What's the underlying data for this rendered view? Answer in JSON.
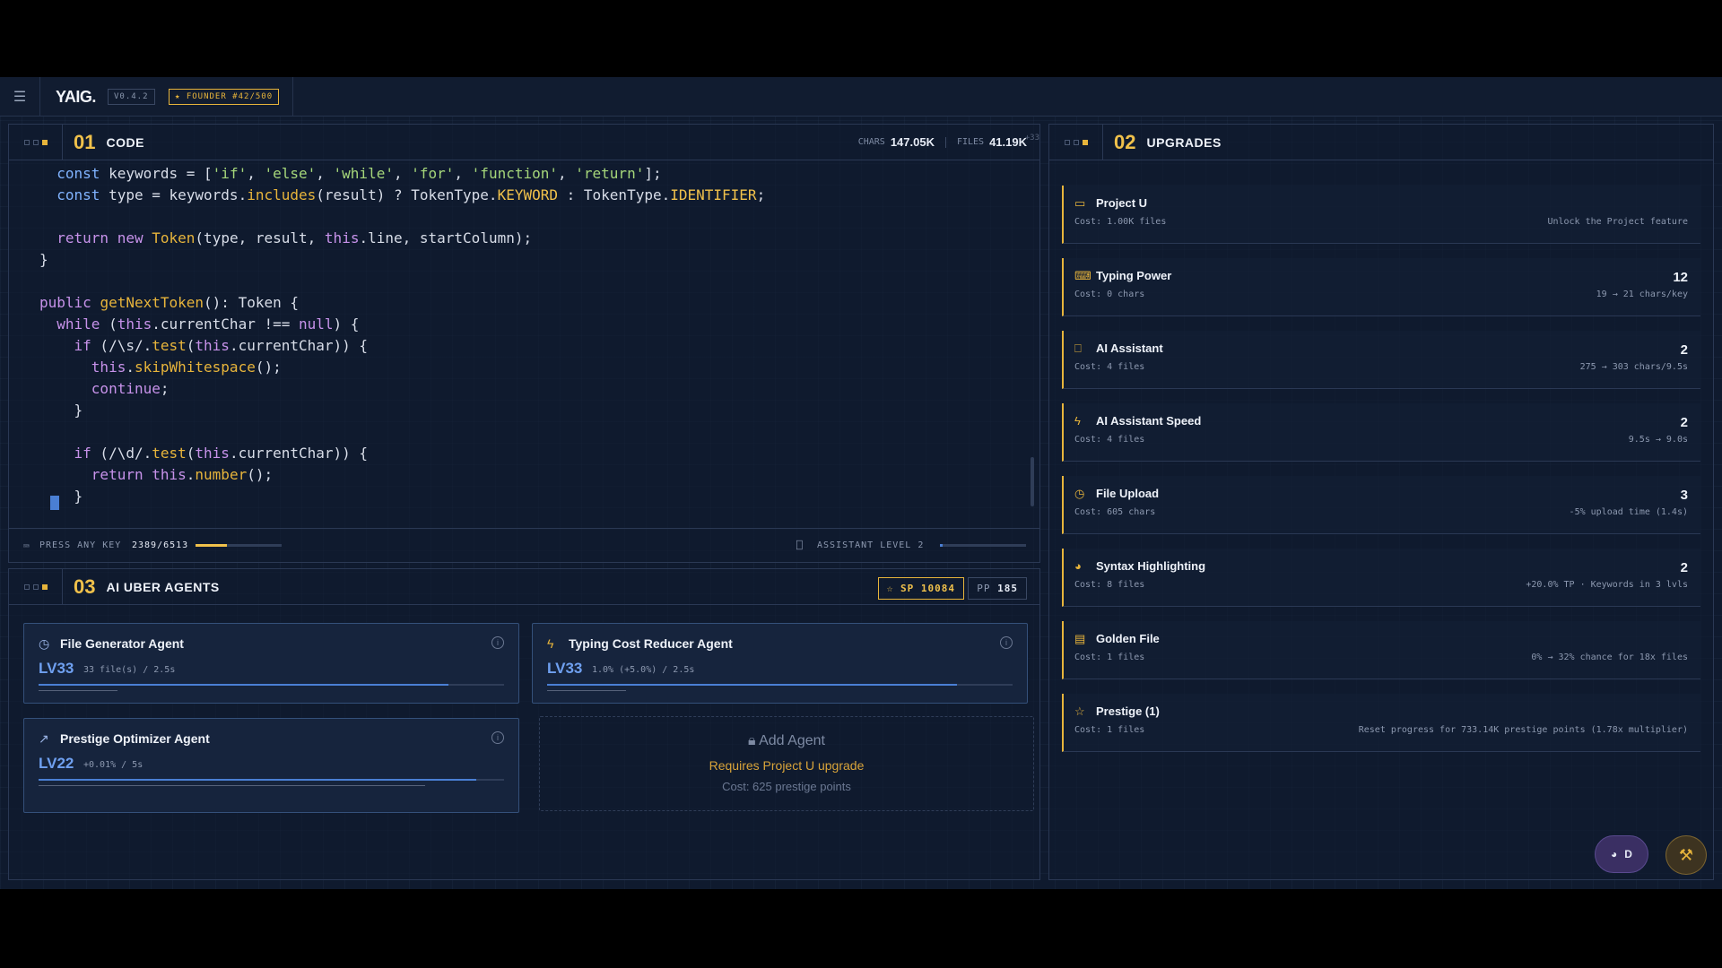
{
  "topbar": {
    "menu_icon": "☰",
    "logo": "YAIG.",
    "version": "V0.4.2",
    "founder": "★ FOUNDER #42/500"
  },
  "code_panel": {
    "num": "01",
    "title": "CODE",
    "chars_label": "CHARS",
    "chars_value": "147.05K",
    "files_label": "FILES",
    "files_value": "41.19K",
    "files_delta": "+33",
    "press_label": "PRESS ANY KEY",
    "progress_text": "2389/6513",
    "progress_fraction": 0.367,
    "assistant_label": "ASSISTANT LEVEL 2",
    "assistant_fraction": 0.03
  },
  "agents_panel": {
    "num": "03",
    "title": "AI UBER AGENTS",
    "sp_label": "SP",
    "sp_value": "10084",
    "pp_label": "PP",
    "pp_value": "185",
    "agents": [
      {
        "name": "File Generator Agent",
        "level": "LV33",
        "stat": "33 file(s) / 2.5s",
        "bar": 0.88,
        "bar2": 0.17,
        "icon": "timer-icon"
      },
      {
        "name": "Typing Cost Reducer Agent",
        "level": "LV33",
        "stat": "1.0% (+5.0%) / 2.5s",
        "bar": 0.88,
        "bar2": 0.17,
        "icon": "bolt-icon"
      },
      {
        "name": "Prestige Optimizer Agent",
        "level": "LV22",
        "stat": "+0.01% / 5s",
        "bar": 0.94,
        "bar2": 0.83,
        "icon": "trend-icon"
      }
    ],
    "add_agent": {
      "title": "Add Agent",
      "requirement": "Requires Project U upgrade",
      "cost": "Cost: 625 prestige points"
    }
  },
  "upgrades_panel": {
    "num": "02",
    "title": "UPGRADES",
    "items": [
      {
        "name": "Project U",
        "cost": "Cost: 1.00K files",
        "level": "",
        "desc": "Unlock the Project feature",
        "icon": "folder-icon"
      },
      {
        "name": "Typing Power",
        "cost": "Cost: 0 chars",
        "level": "12",
        "desc": "19 → 21 chars/key",
        "icon": "keyboard-icon"
      },
      {
        "name": "AI Assistant",
        "cost": "Cost: 4 files",
        "level": "2",
        "desc": "275 → 303 chars/9.5s",
        "icon": "bot-icon"
      },
      {
        "name": "AI Assistant Speed",
        "cost": "Cost: 4 files",
        "level": "2",
        "desc": "9.5s → 9.0s",
        "icon": "bolt-icon"
      },
      {
        "name": "File Upload",
        "cost": "Cost: 605 chars",
        "level": "3",
        "desc": "-5% upload time (1.4s)",
        "icon": "timer-icon"
      },
      {
        "name": "Syntax Highlighting",
        "cost": "Cost: 8 files",
        "level": "2",
        "desc": "+20.0% TP · Keywords in 3 lvls",
        "icon": "palette-icon"
      },
      {
        "name": "Golden File",
        "cost": "Cost: 1 files",
        "level": "",
        "desc": "0% → 32% chance for 18x files",
        "icon": "file-icon"
      },
      {
        "name": "Prestige (1)",
        "cost": "Cost: 1 files",
        "level": "",
        "desc": "Reset progress for 733.14K prestige points (1.78x multiplier)",
        "icon": "star-icon"
      }
    ]
  },
  "floating": {
    "theme_label": "D"
  },
  "code_lines": [
    "    const keywords = ['if', 'else', 'while', 'for', 'function', 'return'];",
    "    const type = keywords.includes(result) ? TokenType.KEYWORD : TokenType.IDENTIFIER;",
    "",
    "    return new Token(type, result, this.line, startColumn);",
    "  }",
    "",
    "  public getNextToken(): Token {",
    "    while (this.currentChar !== null) {",
    "      if (/\\s/.test(this.currentChar)) {",
    "        this.skipWhitespace();",
    "        continue;",
    "      }",
    "",
    "      if (/\\d/.test(this.currentChar)) {",
    "        return this.number();",
    "      }"
  ]
}
